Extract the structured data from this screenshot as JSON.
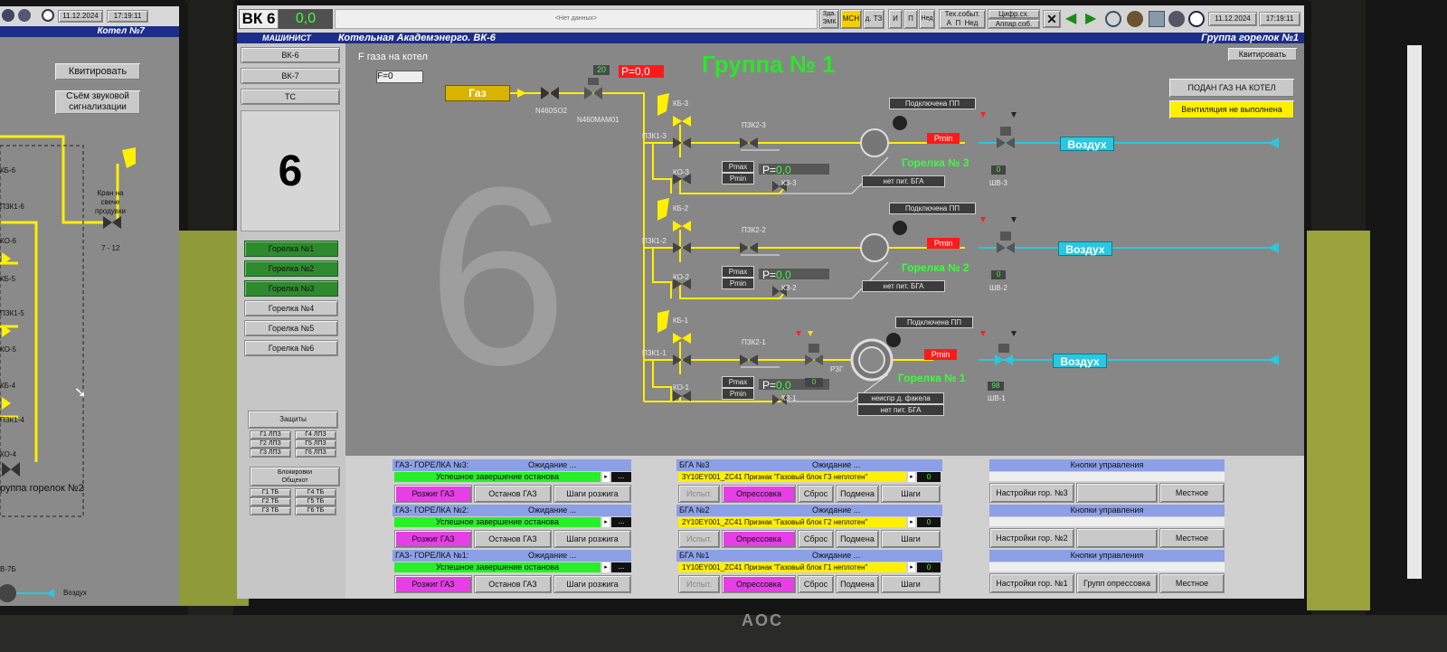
{
  "left_screen": {
    "date": "11.12.2024",
    "time": "17:19:11",
    "title": "Котел №7",
    "ack_button": "Квитировать",
    "sound_button": "Съём звуковой сигнализации",
    "crane_label": "Кран на свече продувки",
    "valve_7_12": "7 - 12",
    "labels": [
      "КБ-6",
      "ПЗК1-6",
      "КО-6",
      "КБ-5",
      "ПЗК1-5",
      "КО-5",
      "КБ-4",
      "ПЗК1-4",
      "КО-4"
    ],
    "group_label": "руппа горелок №2",
    "bottom_label": "В-7Б",
    "air_label": "Воздух"
  },
  "header": {
    "boiler": "ВК 6",
    "value": "0,0",
    "status_center": "<Нет данных>",
    "btn_zdat": "Зда.",
    "btn_emk": "ЭМК",
    "btn_msn": "МСН",
    "btn_dtz": "д. ТЗ",
    "btn_i": "И",
    "btn_p": "П",
    "btn_ned": "Нед",
    "tech_events": "Тех.событ.",
    "tech_a": "А",
    "tech_p": "П",
    "tech_ned": "Нед",
    "digital": "Цифр.сх.",
    "apparat": "Аппар.соб.",
    "date": "11.12.2024",
    "time": "17:19:11"
  },
  "titlebar": {
    "role": "МАШИНИСТ",
    "station": "Котельная Академэнерго. ВК-6",
    "group": "Группа горелок №1"
  },
  "sidebar": {
    "boilers": [
      "ВК-6",
      "ВК-7",
      "ТС"
    ],
    "big_number": "6",
    "burners": [
      "Горелка №1",
      "Горелка №2",
      "Горелка №3",
      "Горелка №4",
      "Горелка №5",
      "Горелка №6"
    ],
    "protections_label": "Защиты",
    "protections": [
      "Г1 ЛПЗ",
      "Г4 ЛПЗ",
      "Г2 ЛПЗ",
      "Г5 ЛПЗ",
      "Г3 ЛПЗ",
      "Г6 ЛПЗ"
    ],
    "locks_label": "Блокировки",
    "locks_sub": "Общекот",
    "locks": [
      "Г1 ТБ",
      "Г4 ТБ",
      "Г2 ТБ",
      "Г5 ТБ",
      "Г3 ТБ",
      "Г6 ТБ"
    ]
  },
  "scheme": {
    "gas_flow_title": "F газа на котел",
    "flow_prefix": "F=",
    "flow_value": "0",
    "group_title": "Группа № 1",
    "gas_label": "Газ",
    "valve_n460so2": "N460SO2",
    "valve_n460mam01": "N460MAM01",
    "counter": "20",
    "pressure": "P=0,0",
    "ack_button": "Квитировать",
    "gas_supplied_button": "ПОДАН ГАЗ НА КОТЕЛ",
    "ventilation_warning": "Вентиляция не выполнена",
    "big_watermark": "6",
    "burners": [
      {
        "kb": "КБ-3",
        "pzk1": "ПЗК1-3",
        "pzk2": "ПЗК2-3",
        "ko": "КО-3",
        "kz": "КЗ-3",
        "pmax": "Pmax",
        "pmin": "Pmin",
        "p_prefix": "P=",
        "p_value": "0,0",
        "connected": "Подключена ПП",
        "pmin_alarm": "Pmin",
        "name": "Горелка № 3",
        "no_power": "нет пит. БГА",
        "shv": "ШВ-3",
        "shv_value": "0",
        "air": "Воздух"
      },
      {
        "kb": "КБ-2",
        "pzk1": "ПЗК1-2",
        "pzk2": "ПЗК2-2",
        "ko": "КО-2",
        "kz": "КЗ-2",
        "pmax": "Pmax",
        "pmin": "Pmin",
        "p_prefix": "P=",
        "p_value": "0,0",
        "connected": "Подключена ПП",
        "pmin_alarm": "Pmin",
        "name": "Горелка № 2",
        "no_power": "нет пит. БГА",
        "shv": "ШВ-2",
        "shv_value": "0",
        "air": "Воздух"
      },
      {
        "kb": "КБ-1",
        "pzk1": "ПЗК1-1",
        "pzk2": "ПЗК2-1",
        "ko": "КО-1",
        "kz": "КЗ-1",
        "pmax": "Pmax",
        "pmin": "Pmin",
        "p_prefix": "P=",
        "p_value": "0,0",
        "connected": "Подключена ПП",
        "pmin_alarm": "Pmin",
        "name": "Горелка № 1",
        "no_power": "нет пит. БГА",
        "flame_fault": "неиспр д. факела",
        "rzg": "РЗГ",
        "rzg_value": "0",
        "shv": "ШВ-1",
        "shv_value": "98",
        "air": "Воздух"
      }
    ]
  },
  "bottom": {
    "gas_panels": [
      {
        "title": "ГАЗ- ГОРЕЛКА №3:",
        "state": "Ожидание ...",
        "status": "Успешное завершение останова",
        "more": "...",
        "ignite": "Розжиг ГАЗ",
        "stop": "Останов ГАЗ",
        "steps": "Шаги розжига"
      },
      {
        "title": "ГАЗ- ГОРЕЛКА №2:",
        "state": "Ожидание ...",
        "status": "Успешное завершение останова",
        "more": "...",
        "ignite": "Розжиг ГАЗ",
        "stop": "Останов ГАЗ",
        "steps": "Шаги розжига"
      },
      {
        "title": "ГАЗ- ГОРЕЛКА №1:",
        "state": "Ожидание ...",
        "status": "Успешное завершение останова",
        "more": "...",
        "ignite": "Розжиг ГАЗ",
        "stop": "Останов ГАЗ",
        "steps": "Шаги розжига"
      }
    ],
    "bga_panels": [
      {
        "title": "БГА №3",
        "state": "Ожидание ...",
        "status": "3Y10EY001_ZC41 Признак \"Газовый блок Г3 неплотен\"",
        "value": "0",
        "test": "Испыт.",
        "pressure_test": "Опрессовка",
        "reset": "Сброс",
        "substitute": "Подмена",
        "steps": "Шаги"
      },
      {
        "title": "БГА №2",
        "state": "Ожидание ...",
        "status": "2Y10EY001_ZC41 Признак \"Газовый блок Г2 неплотен\"",
        "value": "0",
        "test": "Испыт.",
        "pressure_test": "Опрессовка",
        "reset": "Сброс",
        "substitute": "Подмена",
        "steps": "Шаги"
      },
      {
        "title": "БГА №1",
        "state": "Ожидание ...",
        "status": "1Y10EY001_ZC41 Признак \"Газовый блок Г1 неплотен\"",
        "value": "0",
        "test": "Испыт.",
        "pressure_test": "Опрессовка",
        "reset": "Сброс",
        "substitute": "Подмена",
        "steps": "Шаги"
      }
    ],
    "control_panels": [
      {
        "title": "Кнопки управления",
        "settings": "Настройки гор. №3",
        "middle": "",
        "local": "Местное"
      },
      {
        "title": "Кнопки управления",
        "settings": "Настройки гор. №2",
        "middle": "",
        "local": "Местное"
      },
      {
        "title": "Кнопки управления",
        "settings": "Настройки гор. №1",
        "middle": "Групп опрессовка",
        "local": "Местное"
      }
    ]
  },
  "monitor_brand": "AOC",
  "colors": {
    "scheme_bg": "#878787",
    "title_bar": "#1c2d8a",
    "gas_line": "#ffef00",
    "air_line": "#29c8e0",
    "alarm_red": "#ff1a1a",
    "ok_green": "#28f028"
  }
}
